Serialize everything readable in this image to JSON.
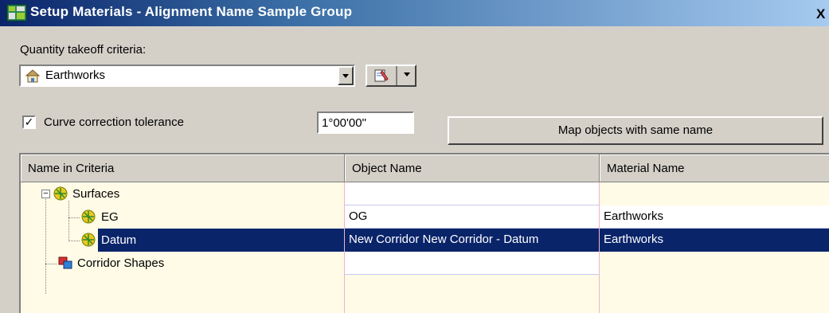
{
  "window": {
    "title": "Setup Materials - Alignment Name Sample Group",
    "close_label": "X"
  },
  "criteria": {
    "label": "Quantity takeoff criteria:",
    "selected": "Earthworks"
  },
  "curve": {
    "checked": true,
    "label": "Curve correction tolerance",
    "value": "1°00'00\""
  },
  "map_button": {
    "label": "Map objects with same name"
  },
  "grid": {
    "headers": {
      "name": "Name in Criteria",
      "object": "Object Name",
      "material": "Material Name"
    },
    "rows": [
      {
        "name": "Surfaces",
        "object": "",
        "material": ""
      },
      {
        "name": "EG",
        "object": "OG",
        "material": "Earthworks"
      },
      {
        "name": "Datum",
        "object": "New Corridor New Corridor - Datum",
        "material": "Earthworks"
      },
      {
        "name": "Corridor Shapes",
        "object": "",
        "material": ""
      }
    ]
  },
  "colors": {
    "selection": "#0a246a",
    "dialog": "#d4d0c8",
    "title_start": "#0a246a",
    "title_end": "#a6caf0"
  }
}
